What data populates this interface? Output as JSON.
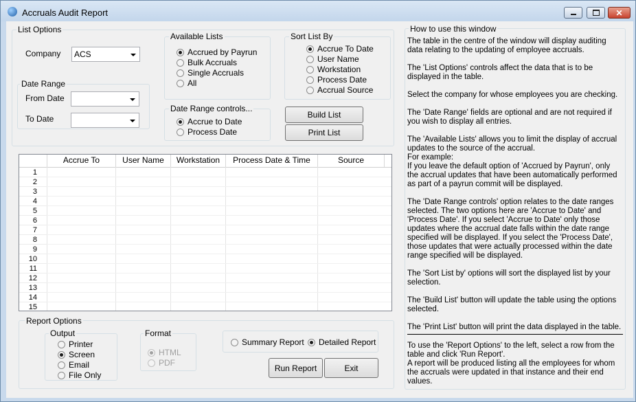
{
  "window": {
    "title": "Accruals Audit Report",
    "controls": {
      "minimize": "minimize",
      "maximize": "maximize",
      "close": "close"
    }
  },
  "list_options": {
    "label": "List Options",
    "company_label": "Company",
    "company_value": "ACS",
    "date_range": {
      "label": "Date Range",
      "from_label": "From Date",
      "from_value": "",
      "to_label": "To Date",
      "to_value": ""
    },
    "available_lists": {
      "label": "Available Lists",
      "options": [
        "Accrued by Payrun",
        "Bulk Accruals",
        "Single Accruals",
        "All"
      ],
      "selected": 0
    },
    "sort_list_by": {
      "label": "Sort List By",
      "options": [
        "Accrue To Date",
        "User Name",
        "Workstation",
        "Process Date",
        "Accrual Source"
      ],
      "selected": 0
    },
    "date_range_controls": {
      "label": "Date Range controls...",
      "options": [
        "Accrue to Date",
        "Process Date"
      ],
      "selected": 0
    },
    "build_list_label": "Build List",
    "print_list_label": "Print List"
  },
  "table": {
    "columns": [
      "Accrue To",
      "User Name",
      "Workstation",
      "Process Date & Time",
      "Source"
    ],
    "row_numbers": [
      "1",
      "2",
      "3",
      "4",
      "5",
      "6",
      "7",
      "8",
      "9",
      "10",
      "11",
      "12",
      "13",
      "14",
      "15"
    ]
  },
  "report_options": {
    "label": "Report Options",
    "output": {
      "label": "Output",
      "options": [
        "Printer",
        "Screen",
        "Email",
        "File Only"
      ],
      "selected": 1
    },
    "format": {
      "label": "Format",
      "options": [
        "HTML",
        "PDF"
      ],
      "selected": 0,
      "disabled": true
    },
    "report_type": {
      "options": [
        "Summary Report",
        "Detailed Report"
      ],
      "selected": 1
    },
    "run_report_label": "Run Report",
    "exit_label": "Exit"
  },
  "help": {
    "label": "How to use this window",
    "paragraphs": [
      "The table in the centre of the window will display auditing data relating to the updating of employee accruals.",
      "The 'List Options' controls affect the data that is to be displayed in the table.",
      "Select the company for whose employees you are checking.",
      "The 'Date Range' fields are optional and are not required if you wish to display all entries.",
      "The 'Available Lists' allows you to limit the display of accrual updates to the source of the accrual.",
      "For example:",
      "If you leave the default option of 'Accrued by Payrun', only the accrual updates that have been automatically performed as part of a payrun commit will be displayed.",
      "The 'Date Range controls' option relates to the date ranges selected.  The two options here are 'Accrue to Date' and 'Process Date'.  If you select 'Accrue to Date' only those updates where the accrual date falls within the date range specified will be displayed.  If you select the 'Process Date', those updates that were actually processed within the date range specified will be displayed.",
      "The 'Sort List by' options will sort the displayed list by your selection.",
      "The 'Build List' button will update the table using the options selected.",
      "The 'Print List' button will print the data displayed in the table.",
      "To use the 'Report Options' to the left, select a row from the table and click 'Run Report'.",
      "A report will be produced listing all the employees for whom the accruals were updated in that instance and their end values."
    ]
  }
}
